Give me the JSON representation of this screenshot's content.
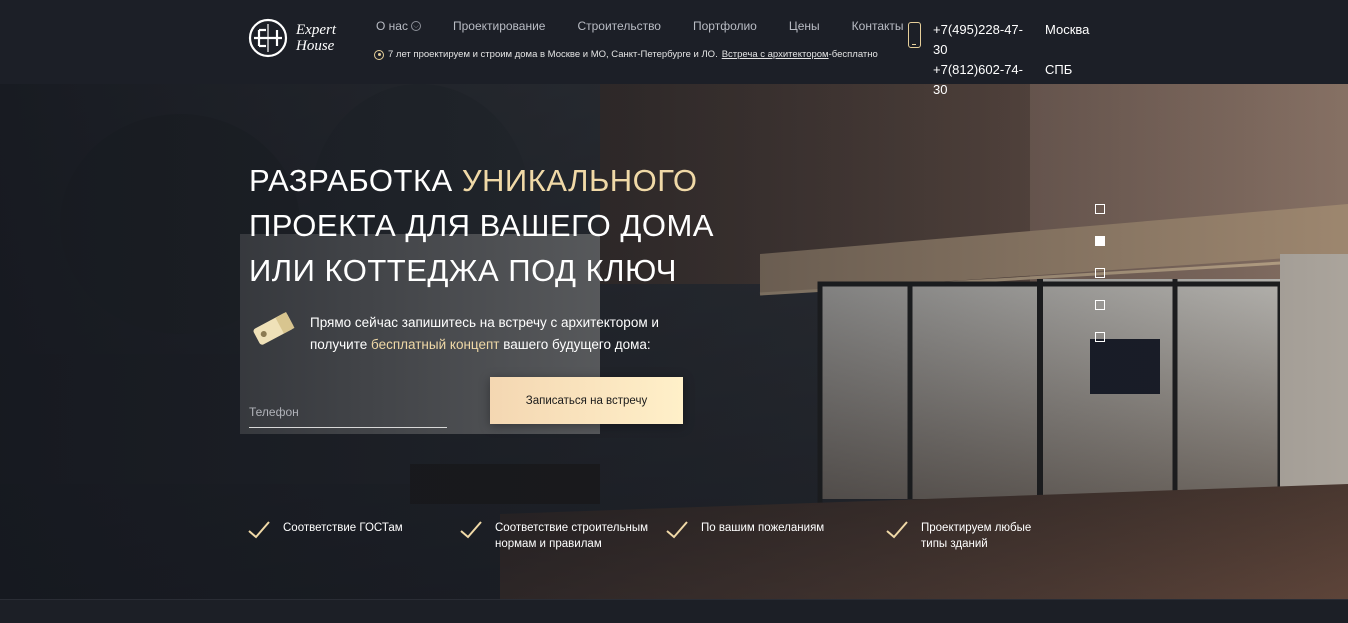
{
  "brand": {
    "logo_line1": "Expert",
    "logo_line2": "House"
  },
  "nav": {
    "items": [
      {
        "label": "О нас",
        "has_dropdown": true
      },
      {
        "label": "Проектирование"
      },
      {
        "label": "Строительство"
      },
      {
        "label": "Портфолио"
      },
      {
        "label": "Цены"
      },
      {
        "label": "Контакты"
      }
    ]
  },
  "tagline": {
    "text": "7 лет проектируем и строим дома в Москве и МО, Санкт-Петербурге и ЛО.",
    "link": "Встреча с архитектором",
    "suffix": "-бесплатно"
  },
  "contacts": [
    {
      "phone": "+7(495)228-47-30",
      "city": "Москва"
    },
    {
      "phone": "+7(812)602-74-30",
      "city": "СПБ"
    }
  ],
  "hero": {
    "title_line1_white": "РАЗРАБОТКА ",
    "title_line1_accent": "УНИКАЛЬНОГО",
    "title_line2": "ПРОЕКТА ДЛЯ ВАШЕГО ДОМА",
    "title_line3": "ИЛИ КОТТЕДЖА ПОД КЛЮЧ",
    "promo_line1": "Прямо сейчас запишитесь на встречу с архитектором и",
    "promo_pre": "получите ",
    "promo_accent": "бесплатный концепт",
    "promo_post": " вашего будущего дома:",
    "phone_placeholder": "Телефон",
    "cta_label": "Записаться на встречу",
    "slider_count": 5,
    "slider_active": 2
  },
  "features": [
    {
      "line1": "Соответствие ГОСТам",
      "line2": ""
    },
    {
      "line1": "Соответствие строительным",
      "line2": "нормам и правилам"
    },
    {
      "line1": "По вашим пожеланиям",
      "line2": ""
    },
    {
      "line1": "Проектируем любые",
      "line2": "типы зданий"
    }
  ],
  "colors": {
    "accent": "#f0d9a7",
    "header_bg": "#1c1f27",
    "cta_gradient_start": "#f4d7b2",
    "cta_gradient_end": "#fff0c9"
  }
}
